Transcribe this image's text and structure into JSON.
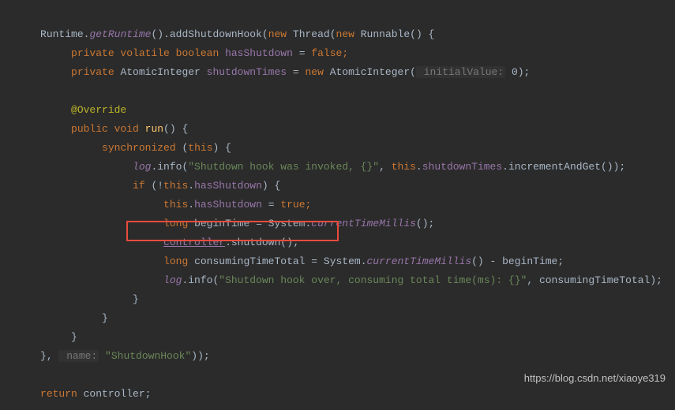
{
  "code": {
    "l1_a": "Runtime.",
    "l1_b": "getRuntime",
    "l1_c": "().addShutdownHook(",
    "l1_d": "new ",
    "l1_e": "Thread(",
    "l1_f": "new ",
    "l1_g": "Runnable() {",
    "l2_a": "private volatile boolean ",
    "l2_b": "hasShutdown ",
    "l2_c": "= ",
    "l2_d": "false",
    "l2_e": ";",
    "l3_a": "private ",
    "l3_b": "AtomicInteger ",
    "l3_c": "shutdownTimes ",
    "l3_d": "= ",
    "l3_e": "new ",
    "l3_f": "AtomicInteger(",
    "l3_hint": " initialValue:",
    "l3_g": " 0",
    "l3_h": ");",
    "l5": "@Override",
    "l6_a": "public void ",
    "l6_b": "run",
    "l6_c": "() {",
    "l7_a": "synchronized ",
    "l7_b": "(",
    "l7_c": "this",
    "l7_d": ") {",
    "l8_a": "log",
    "l8_b": ".info(",
    "l8_c": "\"Shutdown hook was invoked, {}\"",
    "l8_d": ", ",
    "l8_e": "this",
    "l8_f": ".",
    "l8_g": "shutdownTimes",
    "l8_h": ".incrementAndGet());",
    "l9_a": "if ",
    "l9_b": "(!",
    "l9_c": "this",
    "l9_d": ".",
    "l9_e": "hasShutdown",
    "l9_f": ") {",
    "l10_a": "this",
    "l10_b": ".",
    "l10_c": "hasShutdown ",
    "l10_d": "= ",
    "l10_e": "true",
    "l10_f": ";",
    "l11_a": "long ",
    "l11_b": "beginTime = System.",
    "l11_c": "currentTimeMillis",
    "l11_d": "();",
    "l12_a": "controller",
    "l12_b": ".shutdown();",
    "l13_a": "long ",
    "l13_b": "consumingTimeTotal = System.",
    "l13_c": "currentTimeMillis",
    "l13_d": "() - beginTime;",
    "l14_a": "log",
    "l14_b": ".info(",
    "l14_c": "\"Shutdown hook over, consuming total time(ms): {}\"",
    "l14_d": ", consumingTimeTotal);",
    "l15": "}",
    "l16": "}",
    "l17": "}",
    "l18_a": "}, ",
    "l18_hint": " name:",
    "l18_b": " ",
    "l18_c": "\"ShutdownHook\"",
    "l18_d": "));",
    "l20_a": "return ",
    "l20_b": "controller;"
  },
  "indent": {
    "i1": "     ",
    "i2": "          ",
    "i3": "               ",
    "i4": "                    ",
    "i5": "                         "
  },
  "watermark": "https://blog.csdn.net/xiaoye319"
}
